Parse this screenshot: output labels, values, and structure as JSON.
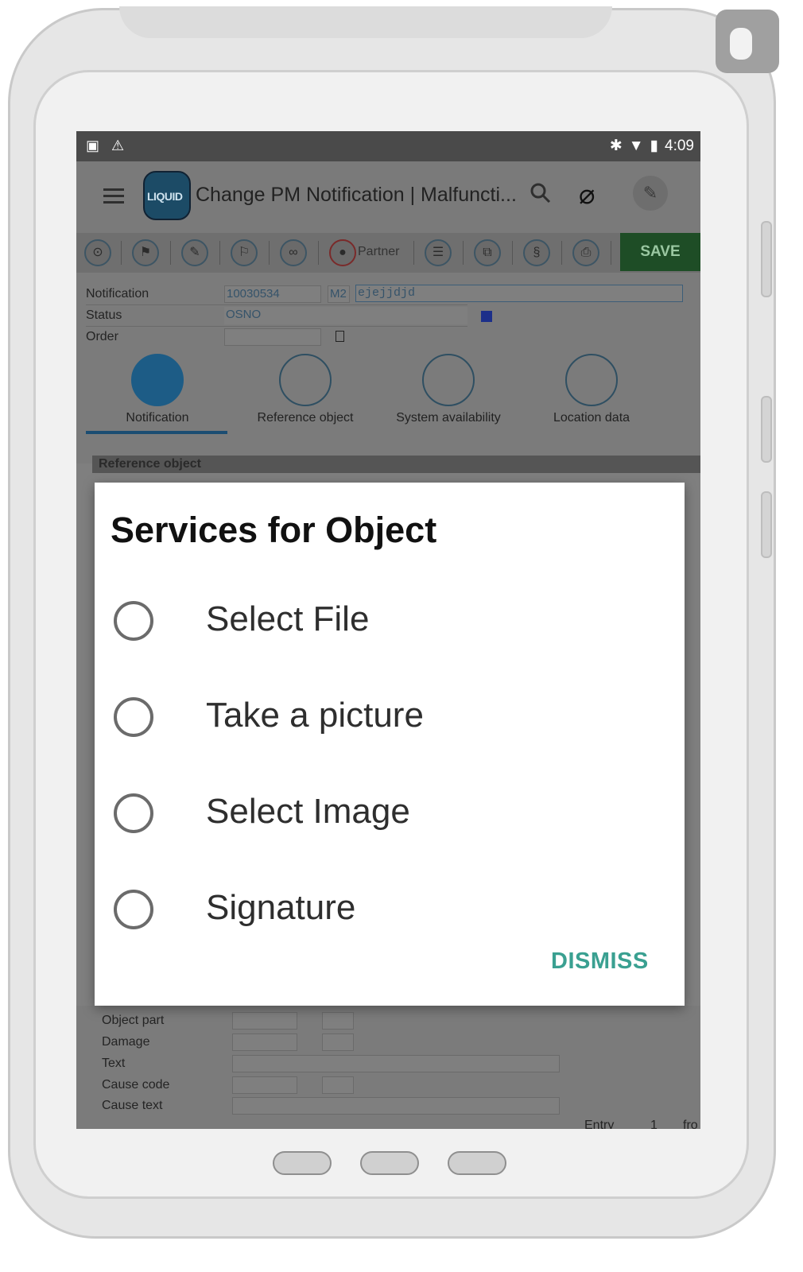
{
  "status_bar": {
    "time": "4:09"
  },
  "app_bar": {
    "logo_text": "LIQUID",
    "title": "Change PM Notification |  Malfuncti..."
  },
  "toolbar": {
    "partner_label": "Partner",
    "save_label": "SAVE"
  },
  "form": {
    "notification_label": "Notification",
    "notification_value": "10030534",
    "type_value": "M2",
    "description_value": "ejejjdjd",
    "status_label": "Status",
    "status_value": "OSNO",
    "order_label": "Order"
  },
  "tabs": [
    {
      "label": "Notification",
      "active": true
    },
    {
      "label": "Reference object",
      "active": false
    },
    {
      "label": "System availability",
      "active": false
    },
    {
      "label": "Location data",
      "active": false
    }
  ],
  "section": {
    "title": "Reference object"
  },
  "bottom_form": {
    "rows": [
      "Object part",
      "Damage",
      "Text",
      "Cause code",
      "Cause text"
    ],
    "footer_left": "Entry",
    "footer_value": "1",
    "footer_right": "fro"
  },
  "dialog": {
    "title": "Services for Object",
    "options": [
      {
        "label": "Select File"
      },
      {
        "label": "Take a picture"
      },
      {
        "label": "Select Image"
      },
      {
        "label": "Signature"
      }
    ],
    "dismiss_label": "DISMISS",
    "accent_color": "#3aa091"
  }
}
